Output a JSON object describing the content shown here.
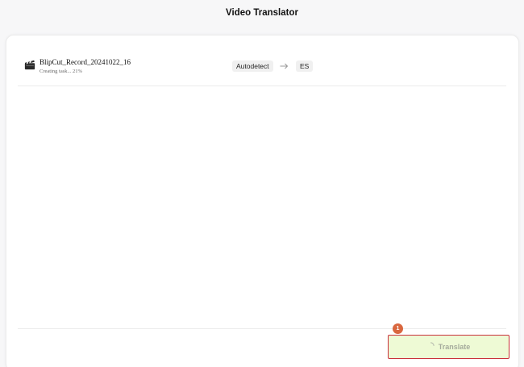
{
  "header": {
    "title": "Video Translator"
  },
  "file": {
    "icon": "clapperboard-icon",
    "name": "BlipCut_Record_20241022_16",
    "status": "Creating task... 21%",
    "progress_percent": 21
  },
  "languages": {
    "source": "Autodetect",
    "arrow_icon": "arrow-right-icon",
    "target": "ES"
  },
  "footer": {
    "translate_label": "Translate",
    "spinner_icon": "spinner-icon",
    "step_badge": "1"
  },
  "colors": {
    "button_bg": "#eefad5",
    "highlight_border": "#c9303a",
    "badge": "#d9673f"
  }
}
